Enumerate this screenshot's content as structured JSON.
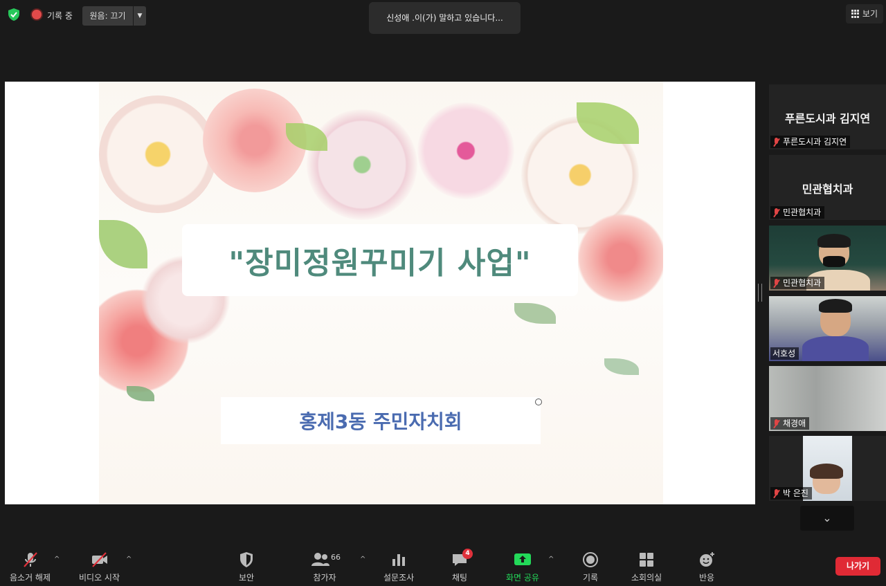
{
  "top_bar": {
    "recording_label": "기록 중",
    "original_sound_label": "원음: 끄기",
    "speaking_banner": "신성애 .이(가) 말하고 있습니다...",
    "view_label": "보기"
  },
  "slide": {
    "title": "\"장미정원꾸미기 사업\"",
    "subtitle": "홍제3동 주민자치회"
  },
  "participants": [
    {
      "center_name": "푸른도시과 김지연",
      "label": "푸른도시과 김지연",
      "muted": true,
      "video": false
    },
    {
      "center_name": "민관협치과",
      "label": "민관협치과",
      "muted": true,
      "video": false
    },
    {
      "label": "민관협치과",
      "muted": true,
      "video": true
    },
    {
      "label": "서호성",
      "muted": false,
      "video": true
    },
    {
      "label": "채경애",
      "muted": true,
      "video": true
    },
    {
      "label": "박 은진",
      "muted": true,
      "video": true
    }
  ],
  "toolbar": {
    "unmute_label": "음소거 해제",
    "start_video_label": "비디오 시작",
    "security_label": "보안",
    "participants_label": "참가자",
    "participants_count": "66",
    "polls_label": "설문조사",
    "chat_label": "채팅",
    "chat_badge": "4",
    "share_label": "화면 공유",
    "record_label": "기록",
    "breakout_label": "소회의실",
    "reactions_label": "반응",
    "leave_label": "나가기"
  },
  "colors": {
    "accent_green": "#23d959",
    "leave_red": "#e02a35",
    "title_green": "#4f8a7c",
    "subtitle_blue": "#4a6bb0"
  }
}
